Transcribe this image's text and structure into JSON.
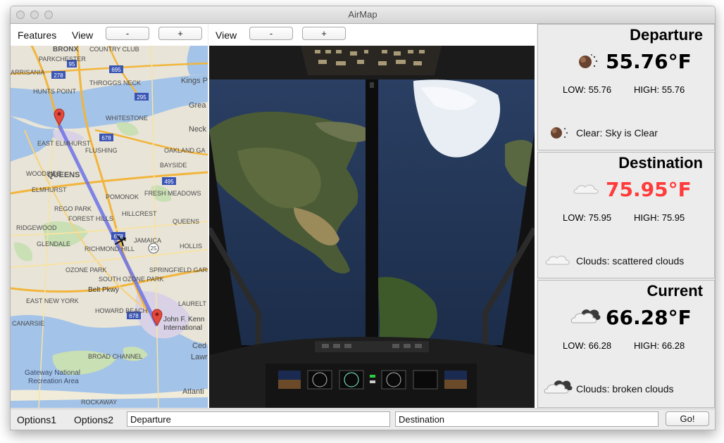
{
  "window": {
    "title": "AirMap"
  },
  "map_panel": {
    "menu": [
      "Features",
      "View"
    ],
    "zoom_out_label": "-",
    "zoom_in_label": "+",
    "labels": {
      "bronx": "BRONX",
      "country_club": "COUNTRY CLUB",
      "parkchester": "PARKCHESTER",
      "arrisania": "ARRISANIA",
      "throggs_neck": "THROGGS NECK",
      "kings_point": "Kings P",
      "hunts_point": "HUNTS POINT",
      "whitestone": "WHITESTONE",
      "great": "Grea",
      "neck": "Neck",
      "east_elmhurst": "EAST ELMHURST",
      "flushing": "FLUSHING",
      "oakland_gardens": "OAKLAND GA",
      "woodside": "WOODSIDE",
      "queens": "QUEENS",
      "bayside": "BAYSIDE",
      "elmhurst": "ELMHURST",
      "pomonok": "POMONOK",
      "fresh_meadows": "FRESH MEADOWS",
      "rego_park": "REGO PARK",
      "hillcrest": "HILLCREST",
      "forest_hills": "FOREST HILLS",
      "ridgewood": "RIDGEWOOD",
      "queens_village": "QUEENS",
      "jamaica": "JAMAICA",
      "glendale": "GLENDALE",
      "richmond_hill": "RICHMOND HILL",
      "hollis": "HOLLIS",
      "ozone_park": "OZONE PARK",
      "south_ozone_park": "SOUTH OZONE PARK",
      "springfield_gardens": "SPRINGFIELD GARDENS",
      "belt_pkwy": "Belt Pkwy",
      "east_new_york": "EAST NEW YORK",
      "laurelton": "LAURELT",
      "howard_beach": "HOWARD BEACH",
      "jfk": "John F. Kenn",
      "jfk2": "International",
      "canarsie": "CANARSIE",
      "cedar": "Ced",
      "lawrence": "Lawr",
      "broad_channel": "BROAD CHANNEL",
      "gateway": "Gateway National",
      "gateway2": "Recreation Area",
      "atlantic": "Atlanti",
      "rockaway": "ROCKAWAY"
    },
    "shields": {
      "i95": "95",
      "i278": "278",
      "i695": "695",
      "i295": "295",
      "i678": "678",
      "i678b": "678",
      "i495": "495",
      "r25": "25",
      "i678c": "678"
    }
  },
  "cockpit_panel": {
    "menu": [
      "View"
    ],
    "zoom_out_label": "-",
    "zoom_in_label": "+"
  },
  "weather": [
    {
      "title": "Departure",
      "temp": "55.76°F",
      "temp_color": "#000000",
      "low": "LOW: 55.76",
      "high": "HIGH: 55.76",
      "desc": "Clear: Sky is Clear",
      "icon": "clear-sky-icon"
    },
    {
      "title": "Destination",
      "temp": "75.95°F",
      "temp_color": "#ff3b3b",
      "low": "LOW: 75.95",
      "high": "HIGH: 75.95",
      "desc": "Clouds: scattered clouds",
      "icon": "scattered-clouds-icon"
    },
    {
      "title": "Current",
      "temp": "66.28°F",
      "temp_color": "#000000",
      "low": "LOW: 66.28",
      "high": "HIGH: 66.28",
      "desc": "Clouds: broken clouds",
      "icon": "broken-clouds-icon"
    }
  ],
  "bottom": {
    "menu": [
      "Options1",
      "Options2"
    ],
    "departure_value": "Departure",
    "destination_value": "Destination",
    "go_label": "Go!"
  }
}
